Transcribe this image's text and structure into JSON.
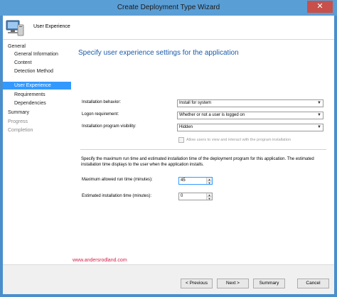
{
  "window": {
    "title": "Create Deployment Type Wizard",
    "close_glyph": "✕"
  },
  "header": {
    "title": "User Experience",
    "icon": "computer-icon"
  },
  "nav": {
    "items": [
      {
        "label": "General",
        "level": "top",
        "state": "normal"
      },
      {
        "label": "General Information",
        "level": "sub",
        "state": "normal"
      },
      {
        "label": "Content",
        "level": "sub",
        "state": "normal"
      },
      {
        "label": "Detection Method",
        "level": "sub",
        "state": "normal"
      },
      {
        "label": "User Experience",
        "level": "sub",
        "state": "selected"
      },
      {
        "label": "Requirements",
        "level": "sub",
        "state": "normal"
      },
      {
        "label": "Dependencies",
        "level": "sub",
        "state": "normal"
      },
      {
        "label": "Summary",
        "level": "top",
        "state": "normal"
      },
      {
        "label": "Progress",
        "level": "top",
        "state": "disabled"
      },
      {
        "label": "Completion",
        "level": "top",
        "state": "disabled"
      }
    ]
  },
  "content": {
    "title": "Specify user experience settings for the application",
    "installation_behavior": {
      "label": "Installation behavior:",
      "value": "Install for system"
    },
    "logon_requirement": {
      "label": "Logon requirement:",
      "value": "Whether or not a user is logged on"
    },
    "program_visibility": {
      "label": "Installation program visibility:",
      "value": "Hidden"
    },
    "allow_interact": {
      "label": "Allow users to view and interact with the program installation",
      "checked": false,
      "enabled": false
    },
    "description": "Specify the maximum run time and estimated installation time of the deployment program for this application. The estimated installation time displays to the user when the application installs.",
    "max_run_time": {
      "label": "Maximum allowed run time (minutes):",
      "value": "45"
    },
    "est_install_time": {
      "label": "Estimated installation time (minutes):",
      "value": "0"
    }
  },
  "watermark": "www.andersrodland.com",
  "footer": {
    "previous": "< Previous",
    "next": "Next >",
    "summary": "Summary",
    "cancel": "Cancel"
  },
  "colors": {
    "accent": "#3399ff",
    "title_blue": "#1a5aa8",
    "titlebar": "#5a9ed6",
    "close_red": "#c7504b",
    "watermark": "#d6204a"
  }
}
